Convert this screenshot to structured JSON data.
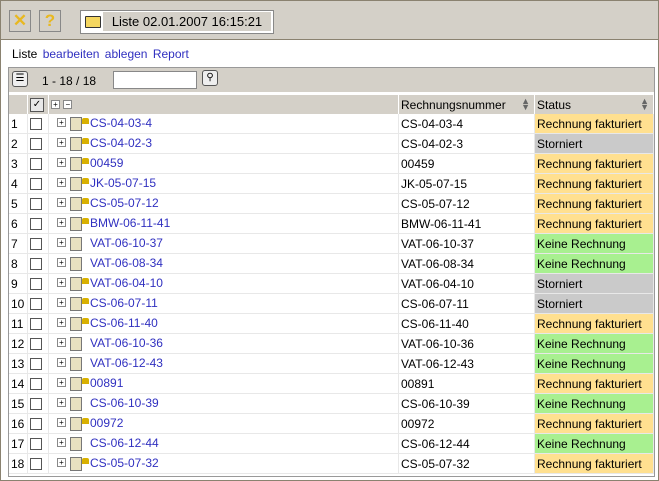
{
  "toolbar": {
    "title": "Liste 02.01.2007 16:15:21"
  },
  "menu": {
    "label": "Liste",
    "items": [
      "bearbeiten",
      "ablegen",
      "Report"
    ]
  },
  "list": {
    "count": "1 - 18 / 18",
    "search_value": ""
  },
  "columns": {
    "number": "Rechnungsnummer",
    "status": "Status"
  },
  "colors": {
    "fakturiert": "#ffe090",
    "storniert": "#cacaca",
    "keine": "#a8f090"
  },
  "rows": [
    {
      "n": "1",
      "name": "CS-04-03-4",
      "num": "CS-04-03-4",
      "status": "Rechnung fakturiert",
      "locked": true
    },
    {
      "n": "2",
      "name": "CS-04-02-3",
      "num": "CS-04-02-3",
      "status": "Storniert",
      "locked": true
    },
    {
      "n": "3",
      "name": "00459",
      "num": "00459",
      "status": "Rechnung fakturiert",
      "locked": true
    },
    {
      "n": "4",
      "name": "JK-05-07-15",
      "num": "JK-05-07-15",
      "status": "Rechnung fakturiert",
      "locked": true
    },
    {
      "n": "5",
      "name": "CS-05-07-12",
      "num": "CS-05-07-12",
      "status": "Rechnung fakturiert",
      "locked": true
    },
    {
      "n": "6",
      "name": "BMW-06-11-41",
      "num": "BMW-06-11-41",
      "status": "Rechnung fakturiert",
      "locked": true
    },
    {
      "n": "7",
      "name": "VAT-06-10-37",
      "num": "VAT-06-10-37",
      "status": "Keine Rechnung",
      "locked": false
    },
    {
      "n": "8",
      "name": "VAT-06-08-34",
      "num": "VAT-06-08-34",
      "status": "Keine Rechnung",
      "locked": false
    },
    {
      "n": "9",
      "name": "VAT-06-04-10",
      "num": "VAT-06-04-10",
      "status": "Storniert",
      "locked": true
    },
    {
      "n": "10",
      "name": "CS-06-07-11",
      "num": "CS-06-07-11",
      "status": "Storniert",
      "locked": true
    },
    {
      "n": "11",
      "name": "CS-06-11-40",
      "num": "CS-06-11-40",
      "status": "Rechnung fakturiert",
      "locked": true
    },
    {
      "n": "12",
      "name": "VAT-06-10-36",
      "num": "VAT-06-10-36",
      "status": "Keine Rechnung",
      "locked": false
    },
    {
      "n": "13",
      "name": "VAT-06-12-43",
      "num": "VAT-06-12-43",
      "status": "Keine Rechnung",
      "locked": false
    },
    {
      "n": "14",
      "name": "00891",
      "num": "00891",
      "status": "Rechnung fakturiert",
      "locked": true
    },
    {
      "n": "15",
      "name": "CS-06-10-39",
      "num": "CS-06-10-39",
      "status": "Keine Rechnung",
      "locked": false
    },
    {
      "n": "16",
      "name": "00972",
      "num": "00972",
      "status": "Rechnung fakturiert",
      "locked": true
    },
    {
      "n": "17",
      "name": "CS-06-12-44",
      "num": "CS-06-12-44",
      "status": "Keine Rechnung",
      "locked": false
    },
    {
      "n": "18",
      "name": "CS-05-07-32",
      "num": "CS-05-07-32",
      "status": "Rechnung fakturiert",
      "locked": true
    }
  ]
}
